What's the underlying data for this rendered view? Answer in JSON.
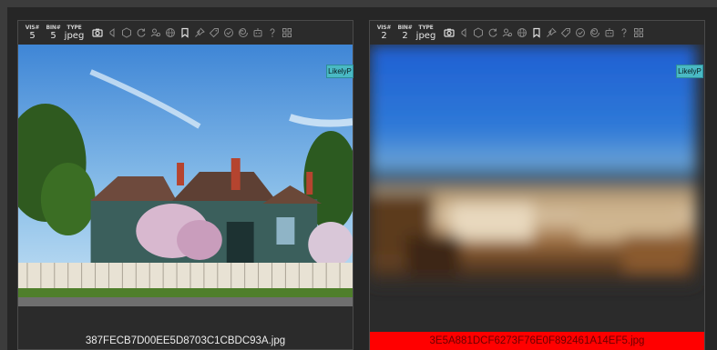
{
  "cards": [
    {
      "stats": [
        {
          "label": "VIS#",
          "value": "5"
        },
        {
          "label": "BIN#",
          "value": "5"
        },
        {
          "label": "TYPE",
          "value": "jpeg"
        }
      ],
      "badge": "LikelyP",
      "filename": "387FECB7D00EE5D8703C1CBDC93A.jpg",
      "flagged": false
    },
    {
      "stats": [
        {
          "label": "VIS#",
          "value": "2"
        },
        {
          "label": "BIN#",
          "value": "2"
        },
        {
          "label": "TYPE",
          "value": "jpeg"
        }
      ],
      "badge": "LikelyP",
      "filename": "3E5A881DCF6273F76E0F892461A14EF5.jpg",
      "flagged": true,
      "flag_color": "#ff0000"
    }
  ],
  "toolbar_icons": [
    "camera-icon",
    "speaker-icon",
    "hexagon-icon",
    "refresh-icon",
    "user-settings-icon",
    "globe-icon",
    "bookmark-icon",
    "pin-icon",
    "tag-icon",
    "check-circle-icon",
    "spiral-icon",
    "robot-icon",
    "help-icon",
    "grid-icon"
  ]
}
